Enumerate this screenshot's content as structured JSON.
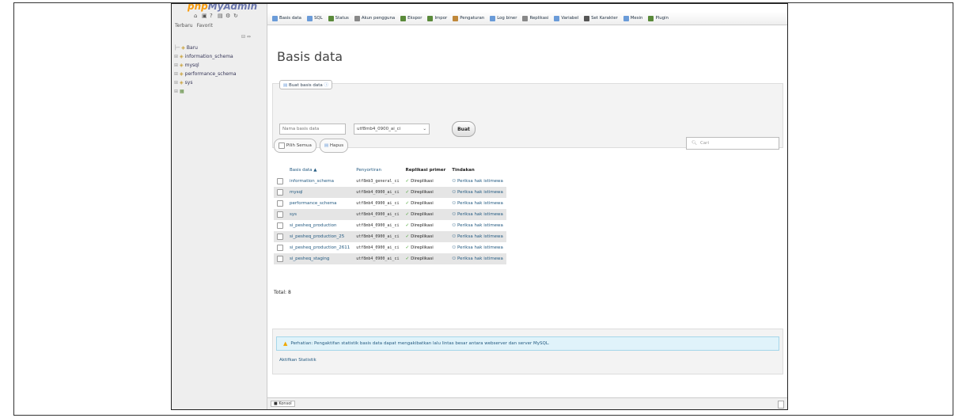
{
  "logo": {
    "part1": "php",
    "part2": "MyAdmin"
  },
  "sidebar": {
    "tabs": [
      "Terbaru",
      "Favorit"
    ],
    "tree": [
      {
        "label": "Baru"
      },
      {
        "label": "information_schema"
      },
      {
        "label": "mysql"
      },
      {
        "label": "performance_schema"
      },
      {
        "label": "sys"
      }
    ]
  },
  "topbar": {
    "tabs": [
      {
        "label": "Basis data",
        "color": "#6a9bd8"
      },
      {
        "label": "SQL",
        "color": "#6a9bd8"
      },
      {
        "label": "Status",
        "color": "#5a8a3a"
      },
      {
        "label": "Akun pengguna",
        "color": "#888888"
      },
      {
        "label": "Ekspor",
        "color": "#5a8a3a"
      },
      {
        "label": "Impor",
        "color": "#5a8a3a"
      },
      {
        "label": "Pengaturan",
        "color": "#c0883a"
      },
      {
        "label": "Log biner",
        "color": "#6a9bd8"
      },
      {
        "label": "Replikasi",
        "color": "#888888"
      },
      {
        "label": "Variabel",
        "color": "#6a9bd8"
      },
      {
        "label": "Set Karakter",
        "color": "#555555"
      },
      {
        "label": "Mesin",
        "color": "#6a9bd8"
      },
      {
        "label": "Plugin",
        "color": "#5a8a3a"
      }
    ]
  },
  "page": {
    "title": "Basis data"
  },
  "create": {
    "legend": "Buat basis data",
    "name_placeholder": "Nama basis data",
    "collation": "utf8mb4_0900_ai_ci",
    "button": "Buat"
  },
  "actions": {
    "select_all": "Pilih Semua",
    "drop": "Hapus",
    "search_placeholder": "Cari"
  },
  "table": {
    "headers": {
      "name": "Basis data",
      "collation": "Penyortiran",
      "replication": "Replikasi primer",
      "action": "Tindakan"
    },
    "rows": [
      {
        "name": "information_schema",
        "collation": "utf8mb3_general_ci",
        "replication": "Direplikasi",
        "action": "Periksa hak istimewa"
      },
      {
        "name": "mysql",
        "collation": "utf8mb4_0900_ai_ci",
        "replication": "Direplikasi",
        "action": "Periksa hak istimewa"
      },
      {
        "name": "performance_schema",
        "collation": "utf8mb4_0900_ai_ci",
        "replication": "Direplikasi",
        "action": "Periksa hak istimewa"
      },
      {
        "name": "sys",
        "collation": "utf8mb4_0900_ai_ci",
        "replication": "Direplikasi",
        "action": "Periksa hak istimewa"
      },
      {
        "name": "si_pesheq_production",
        "collation": "utf8mb4_0900_ai_ci",
        "replication": "Direplikasi",
        "action": "Periksa hak istimewa"
      },
      {
        "name": "si_pesheq_production_25",
        "collation": "utf8mb4_0900_ai_ci",
        "replication": "Direplikasi",
        "action": "Periksa hak istimewa"
      },
      {
        "name": "si_pesheq_production_2611",
        "collation": "utf8mb4_0900_ai_ci",
        "replication": "Direplikasi",
        "action": "Periksa hak istimewa"
      },
      {
        "name": "si_pesheq_staging",
        "collation": "utf8mb4_0900_ai_ci",
        "replication": "Direplikasi",
        "action": "Periksa hak istimewa"
      }
    ],
    "total": "Total: 8"
  },
  "notice": {
    "text": "Perhatian: Pengaktifan statistik basis data dapat mengakibatkan lalu lintas besar antara webserver dan server MySQL.",
    "enable_stats": "Aktifkan Statistik"
  },
  "console": {
    "label": "Konsol"
  }
}
